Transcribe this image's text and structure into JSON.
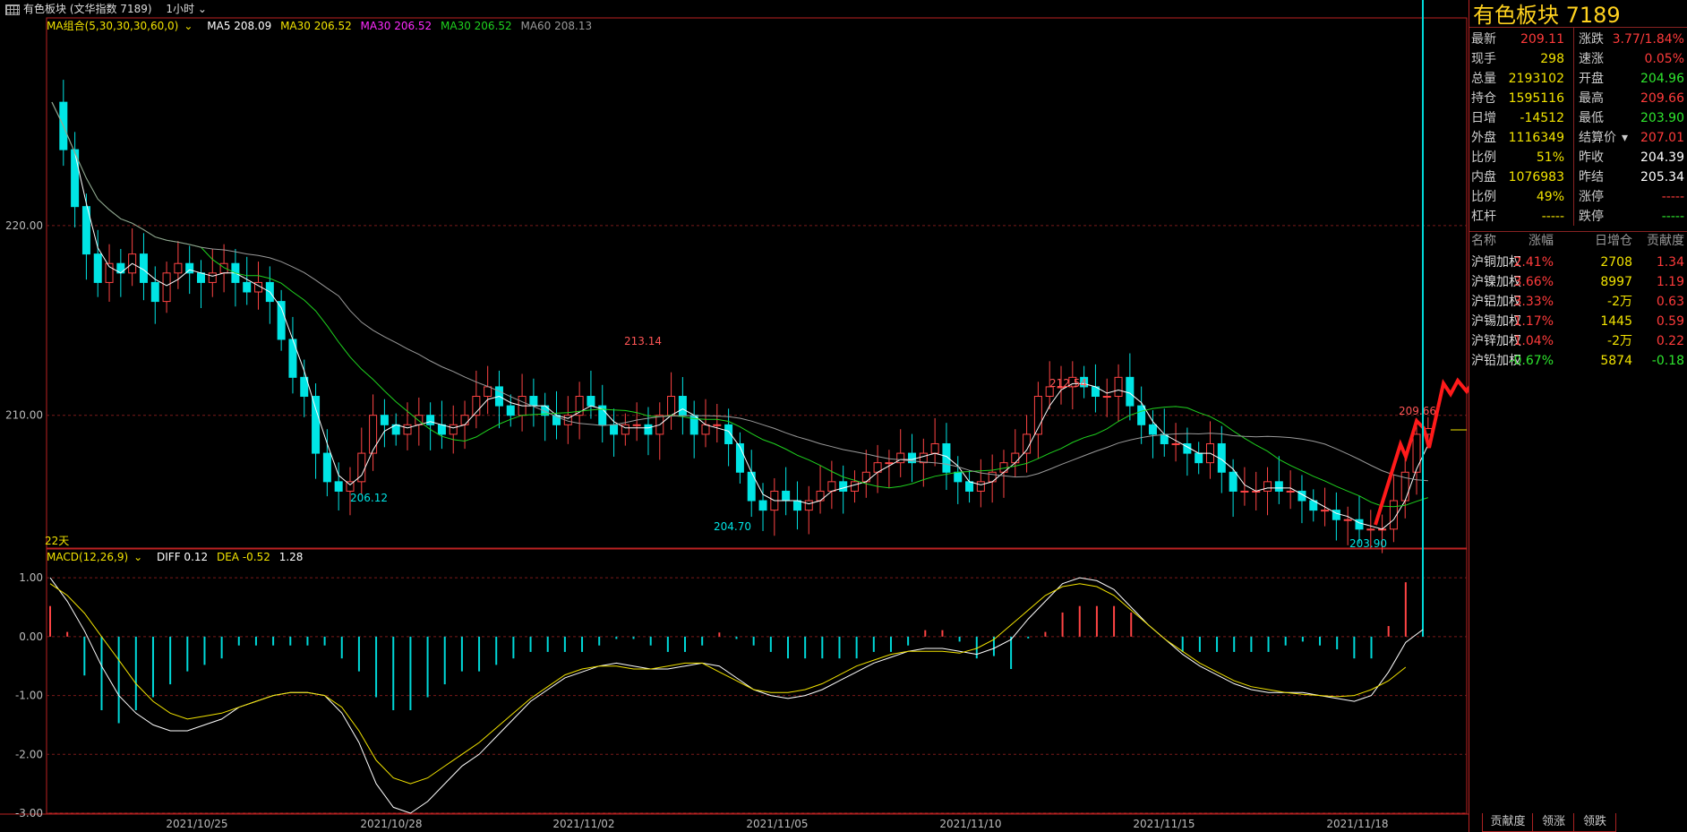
{
  "topbar": {
    "icon": "grid-icon",
    "title": "有色板块 (文华指数 7189)",
    "period": "1小时"
  },
  "main_legend": {
    "group": "MA组合(5,30,30,30,60,0)",
    "items": [
      {
        "label": "MA5 208.09",
        "color": "#ffffff"
      },
      {
        "label": "MA30 206.52",
        "color": "#f2e300"
      },
      {
        "label": "MA30 206.52",
        "color": "#ff2bff"
      },
      {
        "label": "MA30 206.52",
        "color": "#1fd21f"
      },
      {
        "label": "MA60 208.13",
        "color": "#9a9a9a"
      }
    ]
  },
  "macd_legend": {
    "group": "MACD(12,26,9)",
    "diff": "DIFF 0.12",
    "dea": "DEA -0.52",
    "macd": "1.28"
  },
  "chart_data": {
    "type": "candlestick",
    "price_ticks": [
      "220.00",
      "210.00"
    ],
    "macd_ticks": [
      "1.00",
      "0.00",
      "-1.00",
      "-2.00",
      "-3.00"
    ],
    "x_ticks": [
      "2021/10/25",
      "2021/10/28",
      "2021/11/02",
      "2021/11/05",
      "2021/11/10",
      "2021/11/15",
      "2021/11/18"
    ],
    "annotations": [
      "213.14",
      "212.54",
      "206.12",
      "204.70",
      "203.90",
      "209.66"
    ],
    "period_label": "22天",
    "price_range": [
      203.0,
      230.0
    ],
    "macd_range": [
      -3.0,
      1.2
    ],
    "close": [
      226.5,
      224,
      221,
      218.5,
      217,
      218,
      217.5,
      218.5,
      217,
      216,
      217.5,
      218,
      217.5,
      217,
      217.5,
      218,
      217,
      216.5,
      217,
      216,
      214,
      212,
      211,
      208,
      206.5,
      206,
      206.5,
      208,
      210,
      209.5,
      209,
      209.5,
      210,
      209.5,
      209,
      209.5,
      210,
      211,
      211.5,
      210.5,
      210,
      211,
      210.5,
      210,
      209.5,
      210,
      211,
      210.5,
      209.5,
      209,
      209.5,
      209.5,
      209,
      210,
      211,
      210,
      209,
      209.5,
      209.5,
      208.5,
      207,
      205.5,
      205,
      206,
      205.5,
      205,
      205.5,
      206,
      206.5,
      206,
      206.5,
      207,
      207.5,
      207.5,
      208,
      207.5,
      208,
      208.5,
      207,
      206.5,
      206,
      206.5,
      207,
      207.5,
      208,
      209,
      211,
      211.5,
      211.5,
      212,
      211.5,
      211,
      211,
      212,
      210.5,
      209.5,
      209,
      208.5,
      208.5,
      208,
      207.5,
      208.5,
      207,
      206,
      206,
      206,
      206.5,
      206,
      206,
      205.5,
      205,
      205,
      204.5,
      204.5,
      204,
      204,
      204,
      205.5,
      207,
      209,
      209.3
    ],
    "macd_diff": [
      1.0,
      0.6,
      0.1,
      -0.5,
      -1.0,
      -1.3,
      -1.5,
      -1.6,
      -1.6,
      -1.5,
      -1.4,
      -1.2,
      -1.1,
      -1.0,
      -0.95,
      -0.95,
      -1.0,
      -1.3,
      -1.8,
      -2.5,
      -2.9,
      -3.0,
      -2.8,
      -2.5,
      -2.2,
      -2.0,
      -1.7,
      -1.4,
      -1.1,
      -0.9,
      -0.7,
      -0.6,
      -0.5,
      -0.45,
      -0.5,
      -0.55,
      -0.55,
      -0.5,
      -0.45,
      -0.5,
      -0.7,
      -0.9,
      -1.0,
      -1.05,
      -1.0,
      -0.9,
      -0.75,
      -0.6,
      -0.45,
      -0.35,
      -0.25,
      -0.2,
      -0.2,
      -0.25,
      -0.3,
      -0.2,
      -0.05,
      0.3,
      0.6,
      0.9,
      1.0,
      0.95,
      0.8,
      0.5,
      0.2,
      -0.05,
      -0.3,
      -0.5,
      -0.65,
      -0.8,
      -0.9,
      -0.95,
      -0.95,
      -0.95,
      -1.0,
      -1.05,
      -1.1,
      -1.0,
      -0.6,
      -0.1,
      0.12
    ],
    "macd_dea": [
      0.9,
      0.7,
      0.4,
      0.0,
      -0.4,
      -0.8,
      -1.1,
      -1.3,
      -1.4,
      -1.35,
      -1.3,
      -1.2,
      -1.1,
      -1.0,
      -0.95,
      -0.95,
      -1.0,
      -1.2,
      -1.6,
      -2.1,
      -2.4,
      -2.5,
      -2.4,
      -2.2,
      -2.0,
      -1.8,
      -1.55,
      -1.3,
      -1.05,
      -0.85,
      -0.65,
      -0.55,
      -0.5,
      -0.5,
      -0.55,
      -0.55,
      -0.5,
      -0.45,
      -0.45,
      -0.6,
      -0.75,
      -0.9,
      -0.95,
      -0.95,
      -0.9,
      -0.8,
      -0.65,
      -0.5,
      -0.4,
      -0.3,
      -0.25,
      -0.25,
      -0.25,
      -0.28,
      -0.2,
      -0.05,
      0.2,
      0.45,
      0.7,
      0.85,
      0.9,
      0.85,
      0.7,
      0.45,
      0.2,
      -0.05,
      -0.25,
      -0.45,
      -0.6,
      -0.75,
      -0.85,
      -0.9,
      -0.95,
      -0.98,
      -1.0,
      -1.02,
      -1.0,
      -0.9,
      -0.75,
      -0.52
    ]
  },
  "quote": {
    "title": "有色板块  7189",
    "rows": [
      {
        "l": "最新",
        "v": "209.11",
        "vc": "red",
        "l2": "涨跌",
        "v2": "3.77/1.84%",
        "v2c": "red"
      },
      {
        "l": "现手",
        "v": "298",
        "vc": "yellow",
        "l2": "速涨",
        "v2": "0.05%",
        "v2c": "red"
      },
      {
        "l": "总量",
        "v": "2193102",
        "vc": "yellow",
        "l2": "开盘",
        "v2": "204.96",
        "v2c": "green"
      },
      {
        "l": "持仓",
        "v": "1595116",
        "vc": "yellow",
        "l2": "最高",
        "v2": "209.66",
        "v2c": "red"
      },
      {
        "l": "日增",
        "v": "-14512",
        "vc": "yellow",
        "l2": "最低",
        "v2": "203.90",
        "v2c": "green"
      },
      {
        "l": "外盘",
        "v": "1116349",
        "vc": "yellow",
        "l2": "结算价",
        "v2": "207.01",
        "v2c": "red"
      },
      {
        "l": "比例",
        "v": "51%",
        "vc": "yellow",
        "l2": "昨收",
        "v2": "204.39",
        "v2c": "white"
      },
      {
        "l": "内盘",
        "v": "1076983",
        "vc": "yellow",
        "l2": "昨结",
        "v2": "205.34",
        "v2c": "white"
      },
      {
        "l": "比例",
        "v": "49%",
        "vc": "yellow",
        "l2": "涨停",
        "v2": "-----",
        "v2c": "red"
      },
      {
        "l": "杠杆",
        "v": "-----",
        "vc": "yellow",
        "l2": "跌停",
        "v2": "-----",
        "v2c": "green"
      }
    ]
  },
  "contrib": {
    "headers": [
      "名称",
      "涨幅",
      "日增仓",
      "贡献度"
    ],
    "rows": [
      {
        "name": "沪铜加权",
        "chg": "2.41%",
        "chgc": "red",
        "oi": "2708",
        "c": "1.34",
        "cc": "red"
      },
      {
        "name": "沪镍加权",
        "chg": "3.66%",
        "chgc": "red",
        "oi": "8997",
        "c": "1.19",
        "cc": "red"
      },
      {
        "name": "沪铝加权",
        "chg": "3.33%",
        "chgc": "red",
        "oi": "-2万",
        "c": "0.63",
        "cc": "red"
      },
      {
        "name": "沪锡加权",
        "chg": "1.17%",
        "chgc": "red",
        "oi": "1445",
        "c": "0.59",
        "cc": "red"
      },
      {
        "name": "沪锌加权",
        "chg": "1.04%",
        "chgc": "red",
        "oi": "-2万",
        "c": "0.22",
        "cc": "red"
      },
      {
        "name": "沪铅加权",
        "chg": "-0.67%",
        "chgc": "green",
        "oi": "5874",
        "c": "-0.18",
        "cc": "green"
      }
    ]
  },
  "tabs": [
    "贡献度",
    "领涨",
    "领跌"
  ]
}
